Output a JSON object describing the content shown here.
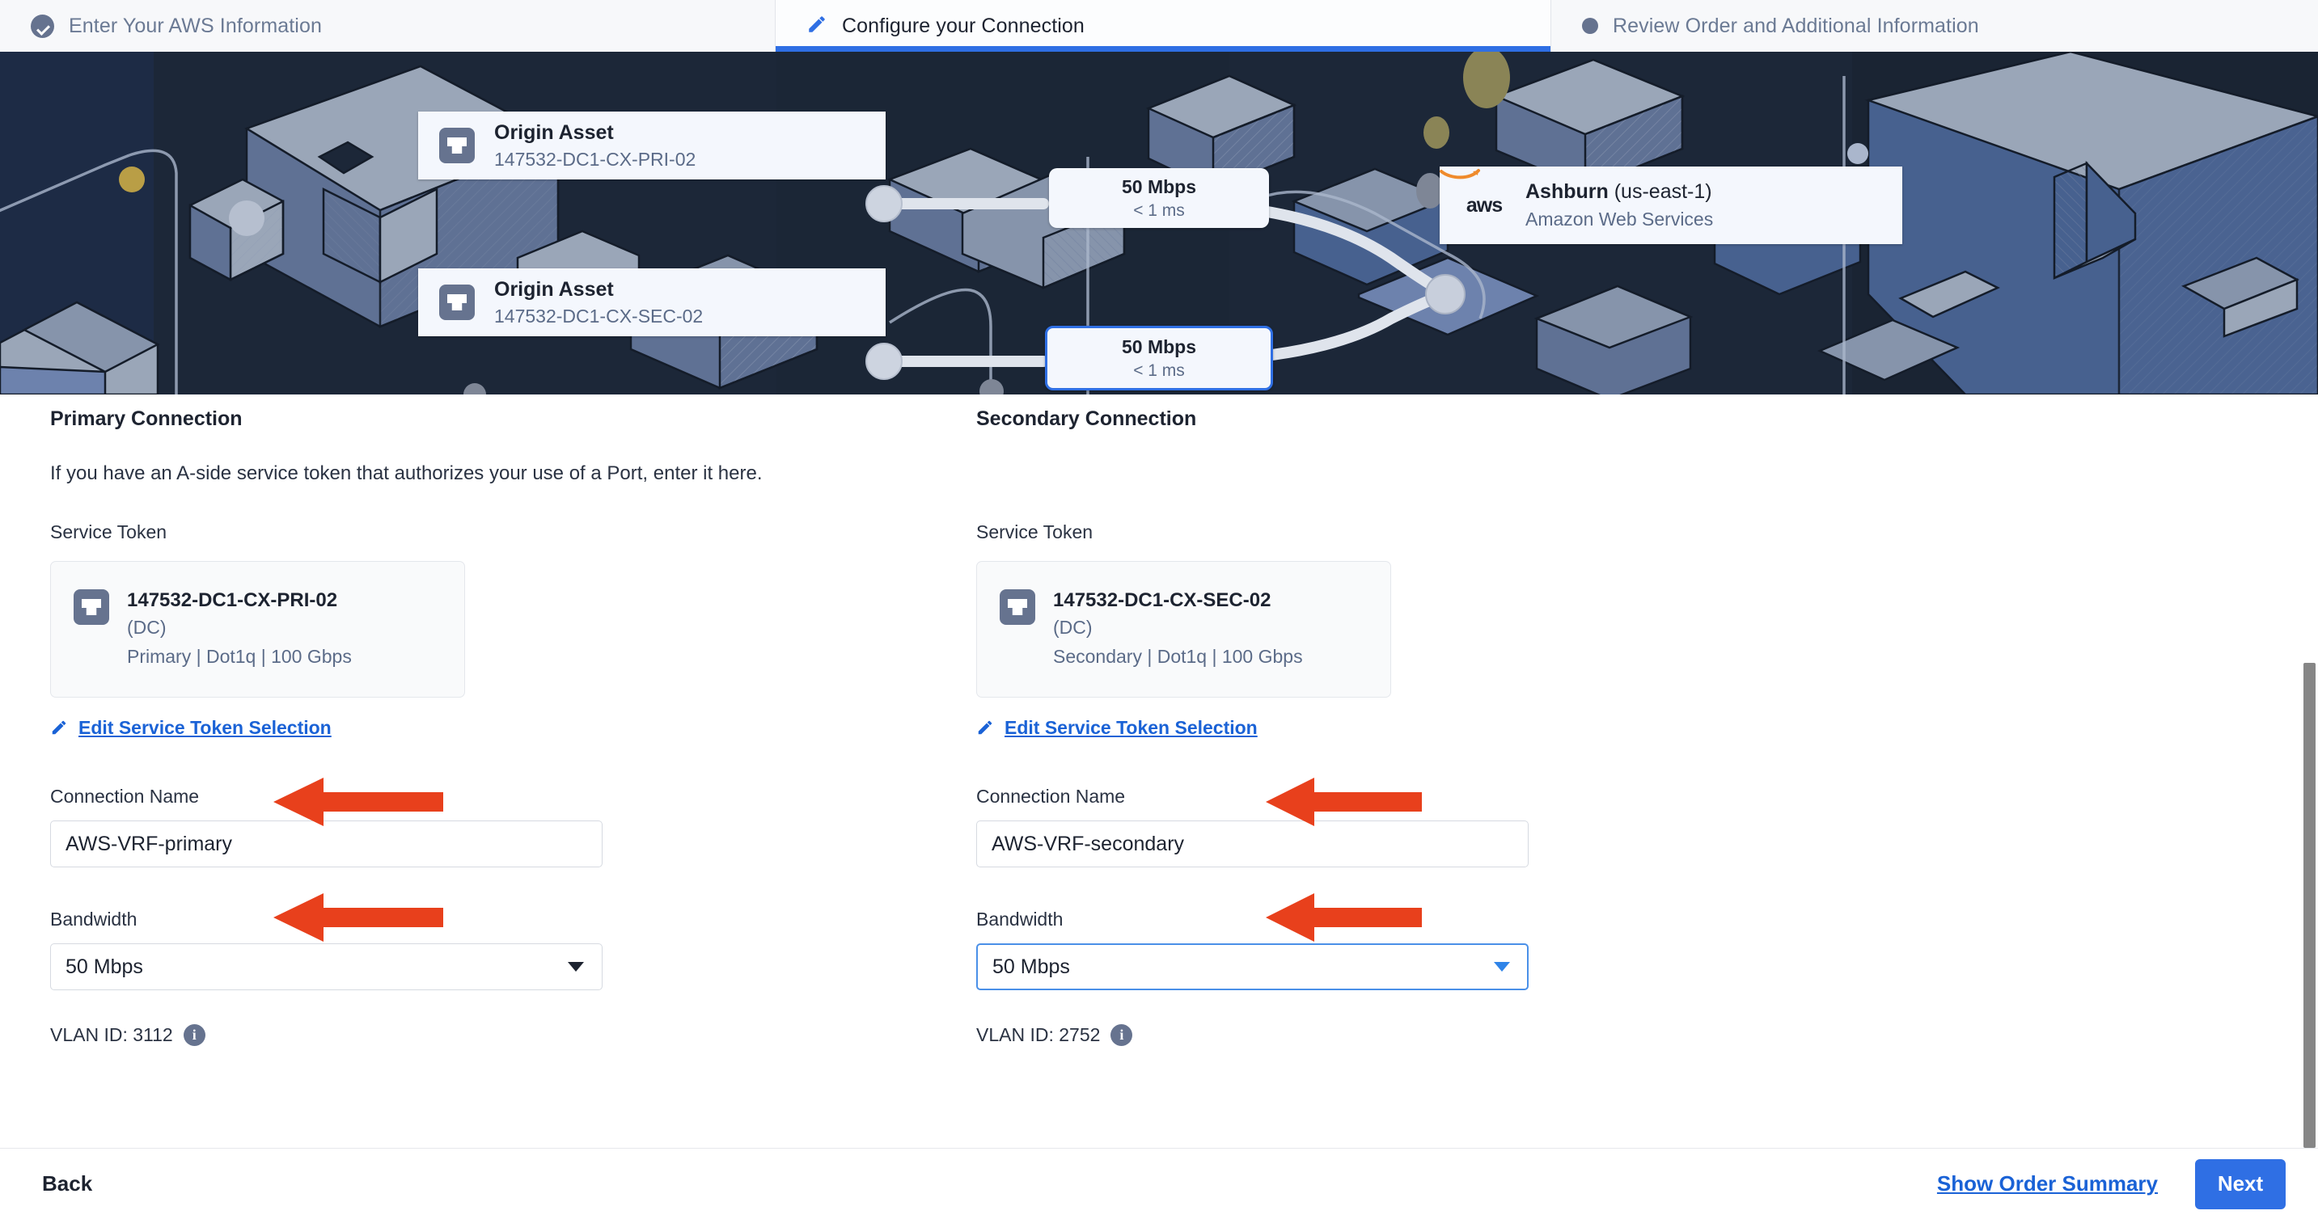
{
  "wizard": {
    "tabs": [
      {
        "label": "Enter Your AWS Information",
        "state": "completed",
        "icon": "check-circle-icon"
      },
      {
        "label": "Configure your Connection",
        "state": "active",
        "icon": "pencil-icon"
      },
      {
        "label": "Review Order and Additional Information",
        "state": "upcoming",
        "icon": "dot-icon"
      }
    ]
  },
  "diagram": {
    "origin_primary": {
      "title": "Origin Asset",
      "subtitle": "147532-DC1-CX-PRI-02",
      "icon": "ethernet-port-icon"
    },
    "origin_secondary": {
      "title": "Origin Asset",
      "subtitle": "147532-DC1-CX-SEC-02",
      "icon": "ethernet-port-icon"
    },
    "link_primary": {
      "bandwidth": "50 Mbps",
      "latency": "< 1 ms",
      "selected": false
    },
    "link_secondary": {
      "bandwidth": "50 Mbps",
      "latency": "< 1 ms",
      "selected": true
    },
    "cloud": {
      "logo_text": "aws",
      "region_name": "Ashburn",
      "region_code": "(us-east-1)",
      "provider": "Amazon Web Services"
    }
  },
  "primary": {
    "heading": "Primary Connection",
    "description": "If you have an A-side service token that authorizes your use of a Port, enter it here.",
    "service_token_label": "Service Token",
    "token": {
      "name": "147532-DC1-CX-PRI-02",
      "location": "(DC)",
      "meta": "Primary | Dot1q | 100 Gbps",
      "icon": "ethernet-port-icon"
    },
    "edit_link": "Edit Service Token Selection",
    "connection_name_label": "Connection Name",
    "connection_name_value": "AWS-VRF-primary",
    "bandwidth_label": "Bandwidth",
    "bandwidth_value": "50 Mbps",
    "bandwidth_focused": false,
    "vlan_text": "VLAN ID: 3112"
  },
  "secondary": {
    "heading": "Secondary Connection",
    "description": "",
    "service_token_label": "Service Token",
    "token": {
      "name": "147532-DC1-CX-SEC-02",
      "location": "(DC)",
      "meta": "Secondary | Dot1q | 100 Gbps",
      "icon": "ethernet-port-icon"
    },
    "edit_link": "Edit Service Token Selection",
    "connection_name_label": "Connection Name",
    "connection_name_value": "AWS-VRF-secondary",
    "bandwidth_label": "Bandwidth",
    "bandwidth_value": "50 Mbps",
    "bandwidth_focused": true,
    "vlan_text": "VLAN ID: 2752"
  },
  "footer": {
    "back_label": "Back",
    "summary_label": "Show Order Summary",
    "next_label": "Next"
  },
  "annotations": {
    "color": "#e8401c",
    "count": 4,
    "shape": "left-arrow"
  },
  "colors": {
    "accent_blue": "#2f6fe4",
    "link_blue": "#1a62d6",
    "banner_navy": "#1c2738",
    "slate": "#66738f",
    "annotation_red": "#e8401c"
  }
}
